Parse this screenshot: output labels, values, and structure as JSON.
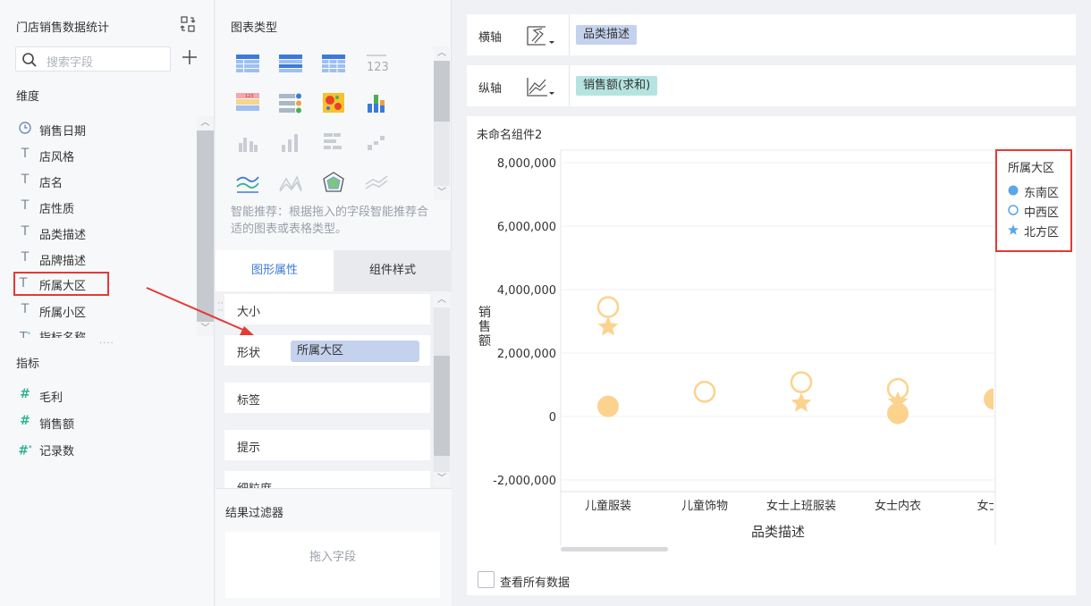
{
  "left": {
    "title": "门店销售数据统计",
    "search_placeholder": "搜索字段",
    "dim_section": "维度",
    "dimensions": [
      {
        "type": "date",
        "label": "销售日期"
      },
      {
        "type": "text",
        "label": "店风格"
      },
      {
        "type": "text",
        "label": "店名"
      },
      {
        "type": "text",
        "label": "店性质"
      },
      {
        "type": "text",
        "label": "品类描述"
      },
      {
        "type": "text",
        "label": "品牌描述"
      },
      {
        "type": "text",
        "label": "所属大区",
        "highlighted": true
      },
      {
        "type": "text",
        "label": "所属小区"
      },
      {
        "type": "text-calc",
        "label": "指标名称"
      }
    ],
    "measure_section": "指标",
    "measures": [
      {
        "type": "number",
        "label": "毛利"
      },
      {
        "type": "number",
        "label": "销售额"
      },
      {
        "type": "number-calc",
        "label": "记录数"
      }
    ]
  },
  "middle": {
    "chart_type_title": "图表类型",
    "hint": "智能推荐：根据拖入的字段智能推荐合适的图表或表格类型。",
    "tabs": {
      "active": "图形属性",
      "inactive": "组件样式"
    },
    "props": {
      "size": "大小",
      "shape": "形状",
      "shape_field": "所属大区",
      "label": "标签",
      "tooltip": "提示",
      "granularity": "细粒度"
    },
    "filter_title": "结果过滤器",
    "filter_placeholder": "拖入字段"
  },
  "axes": {
    "x_label": "横轴",
    "x_field": "品类描述",
    "y_label": "纵轴",
    "y_field": "销售额(求和)"
  },
  "component_name": "未命名组件2",
  "view_all": "查看所有数据",
  "colors": {
    "accent": "#3d7ad8",
    "marker": "#fbd38e",
    "dot_blue": "#5aa6e6",
    "x_pill": "#c5d2ee",
    "y_pill": "#b5e4e0",
    "highlight": "#e53935"
  },
  "chart_data": {
    "type": "scatter",
    "xlabel": "品类描述",
    "ylabel": "销售额",
    "ylim": [
      -2000000,
      8000000
    ],
    "yticks": [
      "8,000,000",
      "6,000,000",
      "4,000,000",
      "2,000,000",
      "0",
      "-2,000,000"
    ],
    "ytick_values": [
      8000000,
      6000000,
      4000000,
      2000000,
      0,
      -2000000
    ],
    "categories": [
      "儿童服装",
      "儿童饰物",
      "女士上班服装",
      "女士内衣",
      "女士成"
    ],
    "legend_title": "所属大区",
    "series": [
      {
        "name": "东南区",
        "marker": "filled-circle",
        "values": [
          320000,
          null,
          null,
          100000,
          550000
        ]
      },
      {
        "name": "中西区",
        "marker": "hollow-circle",
        "values": [
          3450000,
          780000,
          1080000,
          870000,
          null
        ]
      },
      {
        "name": "北方区",
        "marker": "star",
        "values": [
          2820000,
          null,
          420000,
          460000,
          null
        ]
      }
    ]
  }
}
